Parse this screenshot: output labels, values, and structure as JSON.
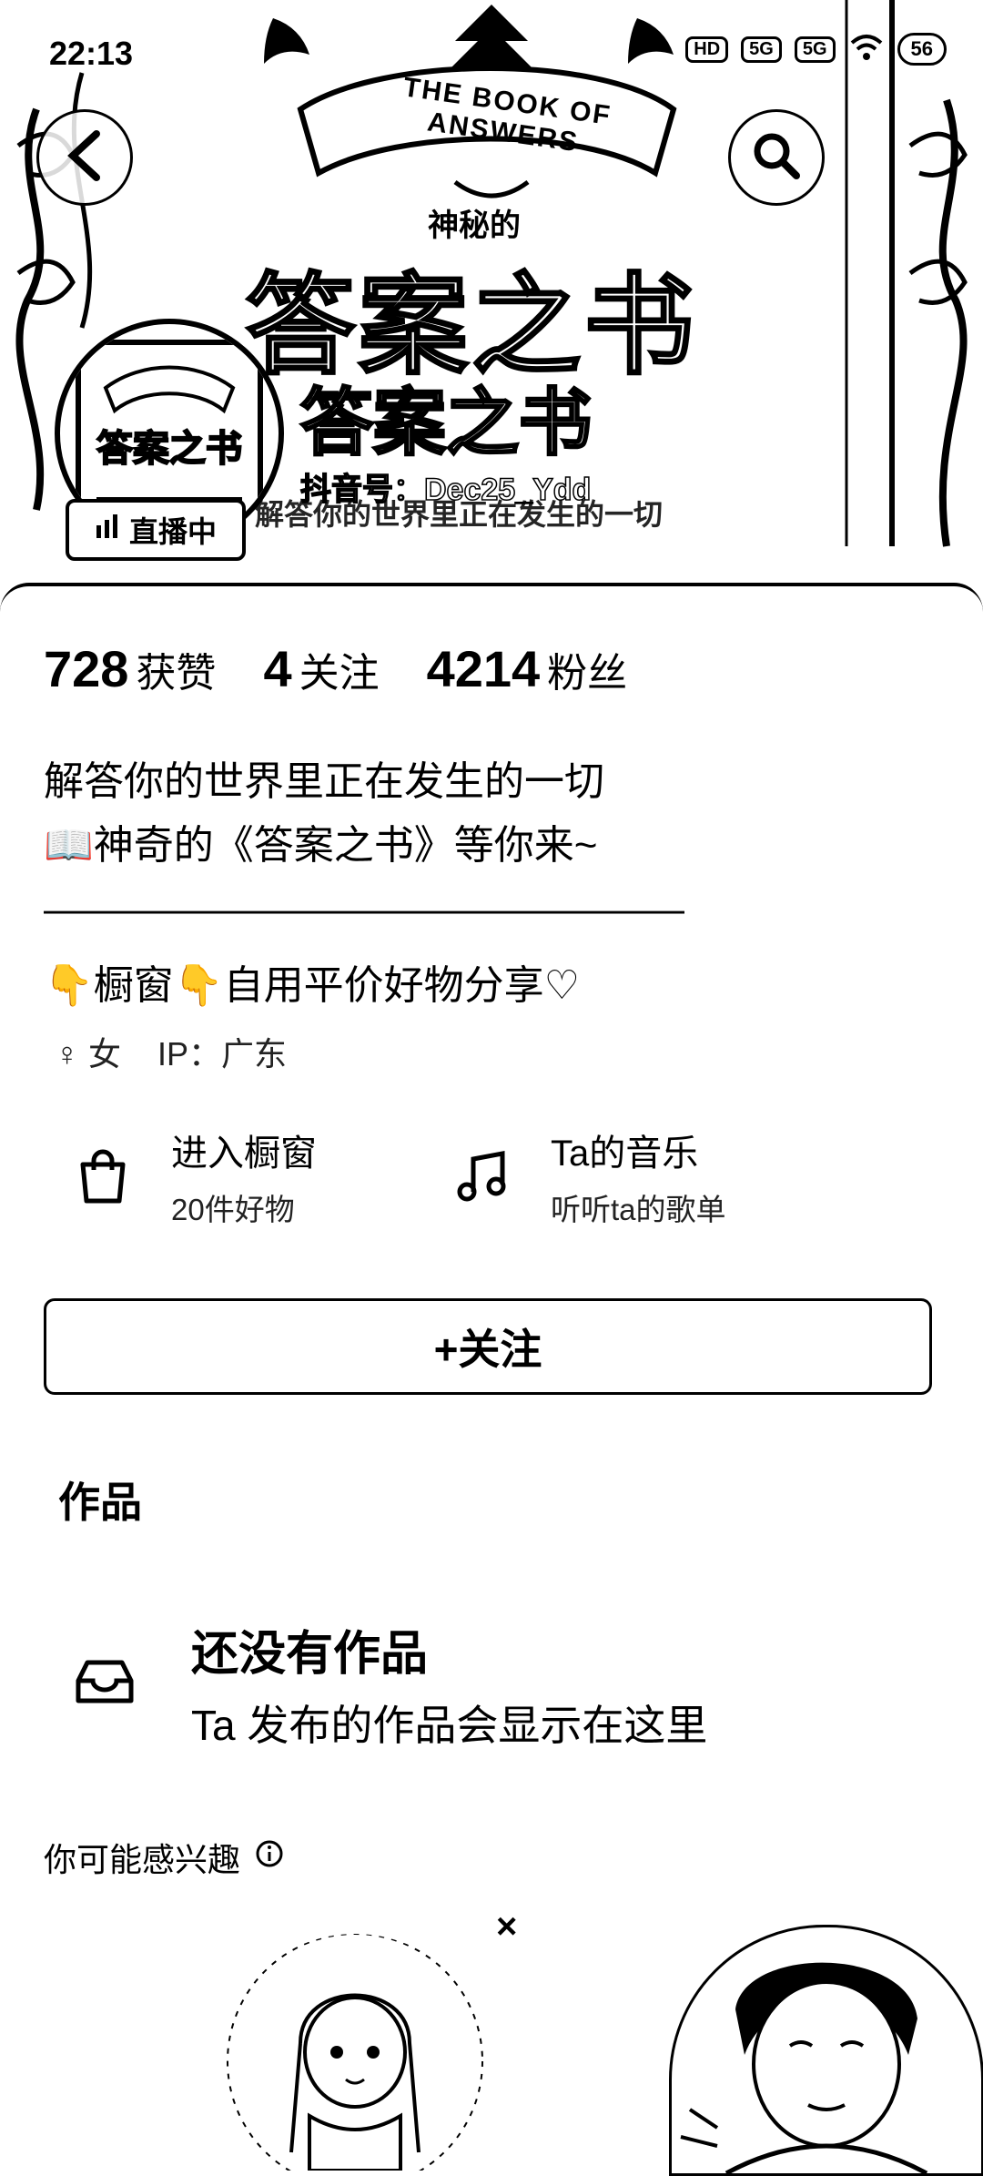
{
  "status_bar": {
    "time": "22:13",
    "hd_label": "HD",
    "signal_1": "5G",
    "signal_2": "5G",
    "battery": "56"
  },
  "banner": {
    "title_en": "THE BOOK OF ANSWERS",
    "subtitle": "神秘的",
    "big_title": "答案之书",
    "mid_title": "答案之书",
    "douyin_id": "抖音号：Dec25_Ydd",
    "caption": "解答你的世界里正在发生的一切"
  },
  "avatar": {
    "live_label": "直播中"
  },
  "stats": [
    {
      "value": "728",
      "label": "获赞"
    },
    {
      "value": "4",
      "label": "关注"
    },
    {
      "value": "4214",
      "label": "粉丝"
    }
  ],
  "bio": {
    "line1": "解答你的世界里正在发生的一切",
    "line2": "📖神奇的《答案之书》等你来~",
    "line3": "————————————————",
    "line4": "👇橱窗👇自用平价好物分享♡"
  },
  "meta": {
    "gender_icon": "♀",
    "gender": "女",
    "ip": "IP：广东"
  },
  "features": [
    {
      "title": "进入橱窗",
      "sub": "20件好物",
      "icon": "shopping-bag-icon"
    },
    {
      "title": "Ta的音乐",
      "sub": "听听ta的歌单",
      "icon": "music-note-icon"
    }
  ],
  "follow_button": "+关注",
  "works": {
    "title": "作品",
    "empty_title": "还没有作品",
    "empty_sub": "Ta 发布的作品会显示在这里"
  },
  "recommend": {
    "title": "你可能感兴趣",
    "close": "×"
  },
  "colors": {
    "foreground": "#000000",
    "background": "#ffffff"
  }
}
